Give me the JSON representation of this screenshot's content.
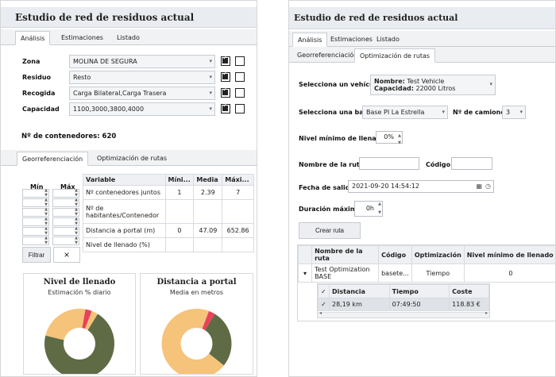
{
  "left": {
    "title": "Estudio de red de residuos actual",
    "tabs": [
      "Análisis",
      "Estimaciones",
      "Listado"
    ],
    "filters": [
      {
        "label": "Zona",
        "value": "MOLINA DE SEGURA",
        "check1": true,
        "check2": false
      },
      {
        "label": "Residuo",
        "value": "Resto",
        "check1": true,
        "check2": false
      },
      {
        "label": "Recogida",
        "value": "Carga Bilateral,Carga Trasera",
        "check1": true,
        "check2": false
      },
      {
        "label": "Capacidad",
        "value": "1100,3000,3800,4000",
        "check1": true,
        "check2": false
      }
    ],
    "containers_label": "Nº de contenedores: 620",
    "subtabs": [
      "Georreferenciación",
      "Optimización de rutas"
    ],
    "minmax": {
      "min_label": "Mín",
      "max_label": "Máx"
    },
    "table": {
      "headers": [
        "Variable",
        "Míni...",
        "Media",
        "Máxi..."
      ],
      "rows": [
        [
          "Nº contenedores juntos",
          "1",
          "2.39",
          "7"
        ],
        [
          "Nº de habitantes/Contenedor",
          "",
          "",
          ""
        ],
        [
          "Distancia a portal (m)",
          "0",
          "47.09",
          "652.86"
        ],
        [
          "Nivel de llenado (%)",
          "",
          "",
          ""
        ]
      ]
    },
    "filter_button": "Filtrar",
    "clear_icon": "close-icon",
    "charts": [
      {
        "title": "Nivel de llenado",
        "subtitle": "Estimación % diario",
        "slices": [
          {
            "value": 70,
            "color": "#5f6b45"
          },
          {
            "value": 24,
            "color": "#f6c37a"
          },
          {
            "value": 3,
            "color": "#e9415a"
          },
          {
            "value": 3,
            "color": "#f6c37a"
          }
        ]
      },
      {
        "title": "Distancia a portal",
        "subtitle": "Media en metros",
        "slices": [
          {
            "value": 27,
            "color": "#5f6b45"
          },
          {
            "value": 70,
            "color": "#f6c37a"
          },
          {
            "value": 3,
            "color": "#e9415a"
          }
        ]
      }
    ]
  },
  "right": {
    "title": "Estudio de red de residuos actual",
    "tabs": [
      "Análisis",
      "Estimaciones",
      "Listado"
    ],
    "subtabs": [
      "Georreferenciación",
      "Optimización de rutas"
    ],
    "vehicle_label": "Selecciona un vehículo",
    "vehicle_name_label": "Nombre:",
    "vehicle_name": "Test Vehicle",
    "vehicle_cap_label": "Capacidad:",
    "vehicle_cap": "22000 Litros",
    "base_label": "Selecciona una base",
    "base_value": "Base PI La Estrella",
    "trucks_label": "Nº de camiones",
    "trucks_value": "3",
    "fill_label": "Nivel mínimo de llenado",
    "fill_value": "0%",
    "route_name_label": "Nombre de la ruta",
    "route_name_value": "",
    "code_label": "Código",
    "code_value": "",
    "date_label": "Fecha de salida",
    "date_value": "2021-09-20 14:54:12",
    "duration_label": "Duración máxima",
    "duration_value": "0h",
    "create_button": "Crear ruta",
    "routes_table": {
      "headers": [
        "Nombre de la ruta",
        "Código",
        "Optimización",
        "Nivel mínimo de llenado"
      ],
      "row": [
        "Test Optimization BASE",
        "basete...",
        "Tiempo",
        "0"
      ]
    },
    "sub_table": {
      "headers": [
        "Distancia",
        "Tiempo",
        "Coste"
      ],
      "row": [
        "28,19 km",
        "07:49:50",
        "118.83 €"
      ]
    }
  }
}
